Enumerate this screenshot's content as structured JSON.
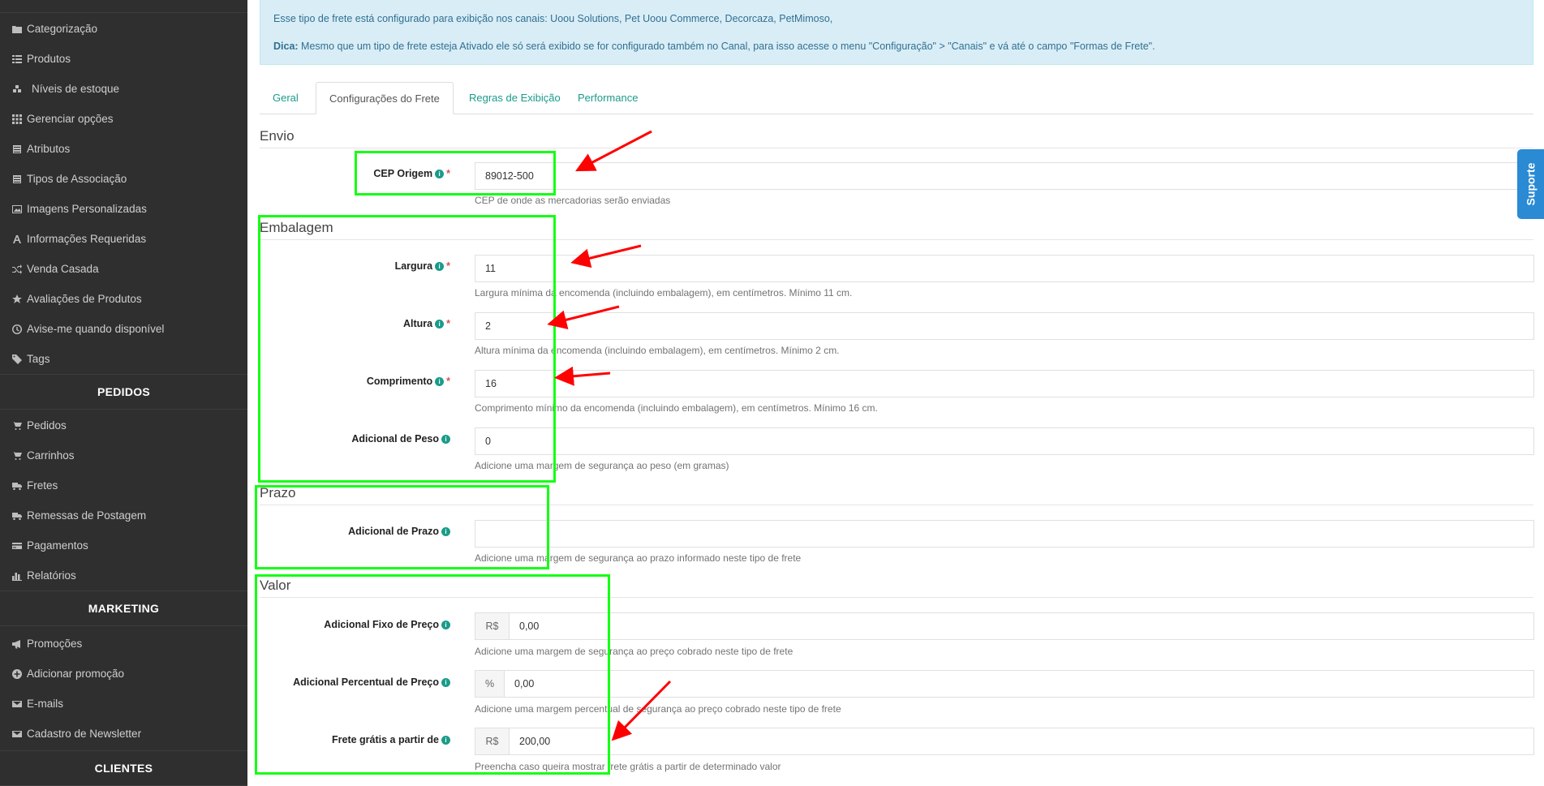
{
  "sidebar": {
    "items": [
      {
        "label": "Categorização",
        "icon": "folder-icon"
      },
      {
        "label": "Produtos",
        "icon": "list-icon"
      },
      {
        "label": "Níveis de estoque",
        "icon": "cubes-icon"
      },
      {
        "label": "Gerenciar opções",
        "icon": "grid-icon"
      },
      {
        "label": "Atributos",
        "icon": "list-alt-icon"
      },
      {
        "label": "Tipos de Associação",
        "icon": "list-alt-icon"
      },
      {
        "label": "Imagens Personalizadas",
        "icon": "image-icon"
      },
      {
        "label": "Informações Requeridas",
        "icon": "font-icon"
      },
      {
        "label": "Venda Casada",
        "icon": "shuffle-icon"
      },
      {
        "label": "Avaliações de Produtos",
        "icon": "star-icon"
      },
      {
        "label": "Avise-me quando disponível",
        "icon": "clock-icon"
      },
      {
        "label": "Tags",
        "icon": "tag-icon"
      }
    ],
    "section_pedidos": "PEDIDOS",
    "pedidos_items": [
      {
        "label": "Pedidos",
        "icon": "cart-icon"
      },
      {
        "label": "Carrinhos",
        "icon": "cart-icon"
      },
      {
        "label": "Fretes",
        "icon": "truck-icon"
      },
      {
        "label": "Remessas de Postagem",
        "icon": "truck-icon"
      },
      {
        "label": "Pagamentos",
        "icon": "credit-card-icon"
      },
      {
        "label": "Relatórios",
        "icon": "bar-chart-icon"
      }
    ],
    "section_marketing": "MARKETING",
    "marketing_items": [
      {
        "label": "Promoções",
        "icon": "bullhorn-icon"
      },
      {
        "label": "Adicionar promoção",
        "icon": "plus-circle-icon"
      },
      {
        "label": "E-mails",
        "icon": "envelope-icon"
      },
      {
        "label": "Cadastro de Newsletter",
        "icon": "envelope-icon"
      }
    ],
    "section_clientes": "CLIENTES"
  },
  "alert": {
    "line1": "Esse tipo de frete está configurado para exibição nos canais: Uoou Solutions, Pet Uoou Commerce, Decorcaza, PetMimoso,",
    "dica_label": "Dica:",
    "dica_text": " Mesmo que um tipo de frete esteja Ativado ele só será exibido se for configurado também no Canal, para isso acesse o menu \"Configuração\" > \"Canais\" e vá até o campo \"Formas de Frete\"."
  },
  "tabs": [
    "Geral",
    "Configurações do Frete",
    "Regras de Exibição",
    "Performance"
  ],
  "sections": {
    "envio": "Envio",
    "embalagem": "Embalagem",
    "prazo": "Prazo",
    "valor": "Valor"
  },
  "fields": {
    "cep": {
      "label": "CEP Origem",
      "value": "89012-500",
      "help": "CEP de onde as mercadorias serão enviadas"
    },
    "largura": {
      "label": "Largura",
      "value": "11",
      "help": "Largura mínima da encomenda (incluindo embalagem), em centímetros. Mínimo 11 cm."
    },
    "altura": {
      "label": "Altura",
      "value": "2",
      "help": "Altura mínima da encomenda (incluindo embalagem), em centímetros. Mínimo 2 cm."
    },
    "comprimento": {
      "label": "Comprimento",
      "value": "16",
      "help": "Comprimento mínimo da encomenda (incluindo embalagem), em centímetros. Mínimo 16 cm."
    },
    "peso": {
      "label": "Adicional de Peso",
      "value": "0",
      "help": "Adicione uma margem de segurança ao peso (em gramas)"
    },
    "prazo": {
      "label": "Adicional de Prazo",
      "value": "",
      "help": "Adicione uma margem de segurança ao prazo informado neste tipo de frete"
    },
    "preco_fixo": {
      "label": "Adicional Fixo de Preço",
      "addon": "R$",
      "value": "0,00",
      "help": "Adicione uma margem de segurança ao preço cobrado neste tipo de frete"
    },
    "preco_percentual": {
      "label": "Adicional Percentual de Preço",
      "addon": "%",
      "value": "0,00",
      "help": "Adicione uma margem percentual de segurança ao preço cobrado neste tipo de frete"
    },
    "frete_gratis": {
      "label": "Frete grátis a partir de",
      "addon": "R$",
      "value": "200,00",
      "help": "Preencha caso queira mostrar frete grátis a partir de determinado valor"
    }
  },
  "info_symbol": "i",
  "required_symbol": "*",
  "suporte_label": "Suporte",
  "colors": {
    "sidebar_bg": "#2f2f2f",
    "accent": "#1b9b8a",
    "highlight": "#14ff14",
    "arrow": "#ff0000",
    "suporte": "#2a8ad4"
  }
}
